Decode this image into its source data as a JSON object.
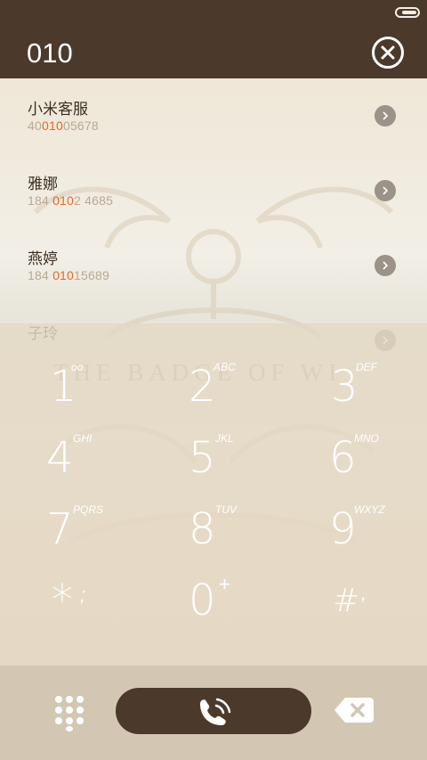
{
  "header": {
    "query": "010"
  },
  "contacts": [
    {
      "name": "小米客服",
      "number_pre": "40",
      "number_match": "010",
      "number_post": "05678"
    },
    {
      "name": "雅娜",
      "number_pre": "184 ",
      "number_match": "010",
      "number_post": "2 4685"
    },
    {
      "name": "燕婷",
      "number_pre": "184 ",
      "number_match": "010",
      "number_post": "15689"
    },
    {
      "name": "子玲",
      "number_pre": "",
      "number_match": "",
      "number_post": ""
    }
  ],
  "keypad": {
    "watermark": "THE BADGE OF WI",
    "keys": [
      {
        "digit": "1",
        "letters": "oo"
      },
      {
        "digit": "2",
        "letters": "ABC"
      },
      {
        "digit": "3",
        "letters": "DEF"
      },
      {
        "digit": "4",
        "letters": "GHI"
      },
      {
        "digit": "5",
        "letters": "JKL"
      },
      {
        "digit": "6",
        "letters": "MNO"
      },
      {
        "digit": "7",
        "letters": "PQRS"
      },
      {
        "digit": "8",
        "letters": "TUV"
      },
      {
        "digit": "9",
        "letters": "WXYZ"
      },
      {
        "digit": "*",
        "letters": ";"
      },
      {
        "digit": "0",
        "letters": "+"
      },
      {
        "digit": "#",
        "letters": ","
      }
    ]
  },
  "colors": {
    "header_bg": "#4b3a2c",
    "highlight": "#e8651f",
    "number_gray": "#b8a993"
  },
  "icons": {
    "clear": "close-circle-icon",
    "chevron": "chevron-right-icon",
    "dialpad": "dialpad-grid-icon",
    "call": "phone-call-icon",
    "backspace": "backspace-icon"
  }
}
